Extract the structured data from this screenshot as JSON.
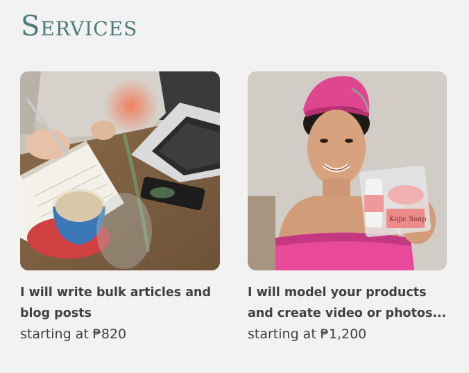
{
  "section": {
    "title": "Services"
  },
  "services": [
    {
      "title": "I will write bulk articles and blog posts",
      "price_prefix": "starting at",
      "price": "₱820",
      "image_icon": "writing-desk-photo"
    },
    {
      "title": "I will model your products and create video or photos...",
      "price_prefix": "starting at",
      "price": "₱1,200",
      "image_icon": "product-model-photo",
      "product_label": "Kojic Soap"
    }
  ],
  "colors": {
    "background": "#f2f2f2",
    "title": "#4d7a7a",
    "text": "#404040",
    "towel_pink": "#e8499a"
  }
}
